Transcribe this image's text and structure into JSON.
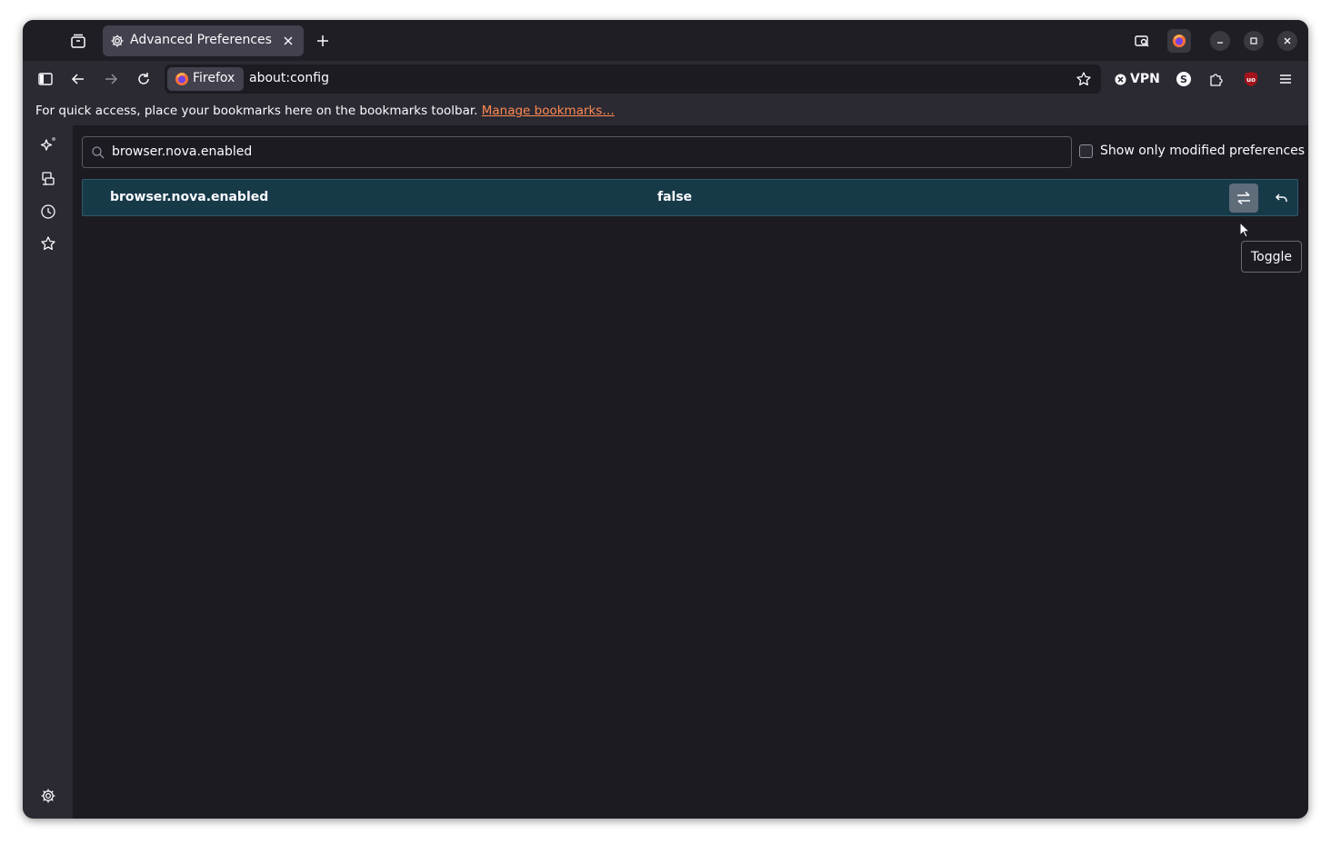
{
  "tab": {
    "title": "Advanced Preferences",
    "icon": "gear-icon"
  },
  "urlbar": {
    "identity_label": "Firefox",
    "url": "about:config"
  },
  "toolbar": {
    "vpn_label": "VPN"
  },
  "bookmarks_bar": {
    "message": "For quick access, place your bookmarks here on the bookmarks toolbar. ",
    "manage_link": "Manage bookmarks…"
  },
  "config": {
    "search_value": "browser.nova.enabled",
    "modified_only_label": "Show only modified preferences",
    "modified_only_checked": false,
    "preference": {
      "name": "browser.nova.enabled",
      "value": "false"
    },
    "tooltip": "Toggle"
  },
  "colors": {
    "accent_link": "#ff8a50",
    "row_highlight": "#173a49",
    "window_bg": "#1c1b22"
  }
}
